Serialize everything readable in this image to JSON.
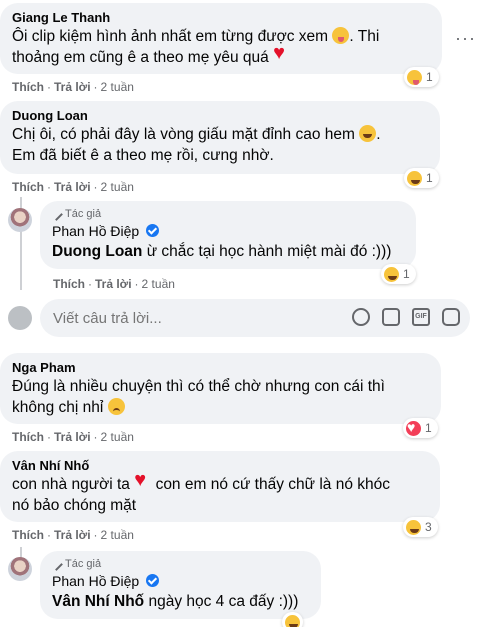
{
  "comments": [
    {
      "author": "Giang Le Thanh",
      "line1": "Ôi clip kiệm hình ảnh nhất em từng được xem",
      "line2": "Thi",
      "line3": "thoảng em cũng ê a theo mẹ yêu quá",
      "like": "Thích",
      "reply": "Trả lời",
      "time": "2 tuần",
      "reaction_count": "1"
    },
    {
      "author": "Duong Loan",
      "line1": "Chị ôi, có phải đây là vòng giấu mặt đỉnh cao hem",
      "line2": "Em đã biết ê a theo mẹ rồi, cưng nhờ.",
      "like": "Thích",
      "reply": "Trả lời",
      "time": "2 tuần",
      "reaction_count": "1"
    },
    {
      "tag": "Tác giả",
      "author": "Phan Hồ Điệp",
      "mention": "Duong Loan",
      "text": "ừ chắc tại học hành miệt mài đó :)))",
      "like": "Thích",
      "reply": "Trả lời",
      "time": "2 tuần",
      "reaction_count": "1"
    },
    {
      "author": "Nga Pham",
      "line1": "Đúng là nhiều chuyện thì có thể chờ nhưng con cái thì",
      "line2": "không chị nhỉ",
      "like": "Thích",
      "reply": "Trả lời",
      "time": "2 tuần",
      "reaction_count": "1"
    },
    {
      "author": "Vân Nhí Nhố",
      "line1": "con nhà người ta",
      "line1b": "con em nó cứ thấy chữ là nó khóc",
      "line2": "nó bảo chóng mặt",
      "like": "Thích",
      "reply": "Trả lời",
      "time": "2 tuần",
      "reaction_count": "3"
    },
    {
      "tag": "Tác giả",
      "author": "Phan Hồ Điệp",
      "mention": "Vân Nhí Nhố",
      "text": "ngày học 4 ca đấy :)))"
    }
  ],
  "reply_box": {
    "placeholder": "Viết câu trả lời..."
  },
  "more_label": "···",
  "colors": {
    "bubble": "#f0f2f5",
    "secondary_text": "#65676b",
    "verified": "#1877f2",
    "heart": "#f33e58"
  },
  "icons": [
    "emoji-icon",
    "camera-icon",
    "gif-icon",
    "sticker-icon",
    "pencil-icon",
    "verified-icon"
  ]
}
